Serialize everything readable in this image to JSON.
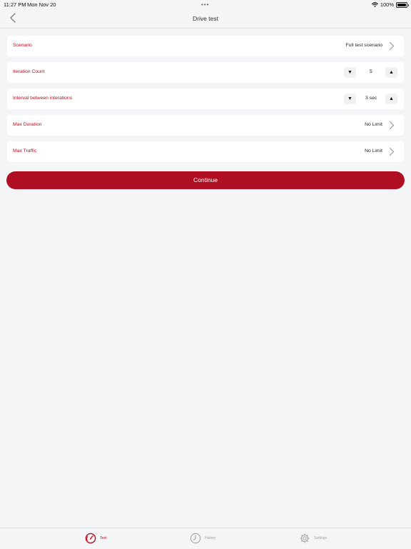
{
  "status_bar": {
    "time": "11:27 PM",
    "date": "Mon Nov 20",
    "dots": "•••",
    "battery_percent": "100%"
  },
  "nav": {
    "title": "Drive test"
  },
  "settings": {
    "scenario": {
      "label": "Scenario",
      "value": "Full test scenario"
    },
    "iteration_count": {
      "label": "Iteration Count",
      "value": "5",
      "decrement": "▼",
      "increment": "▲"
    },
    "interval": {
      "label": "Interval between interations",
      "value": "3 sec",
      "decrement": "▼",
      "increment": "▲"
    },
    "max_duration": {
      "label": "Max Duration",
      "value": "No Limit"
    },
    "max_traffic": {
      "label": "Max Traffic",
      "value": "No Limit"
    }
  },
  "continue_label": "Continue",
  "tabs": [
    {
      "label": "Test",
      "icon": "speedometer-icon",
      "active": true
    },
    {
      "label": "History",
      "icon": "clock-icon",
      "active": false
    },
    {
      "label": "Settings",
      "icon": "gear-icon",
      "active": false
    }
  ],
  "colors": {
    "accent": "#b00f23",
    "background": "#f4f5f7",
    "card": "#ffffff",
    "inactive_tab": "#9a9da2"
  }
}
